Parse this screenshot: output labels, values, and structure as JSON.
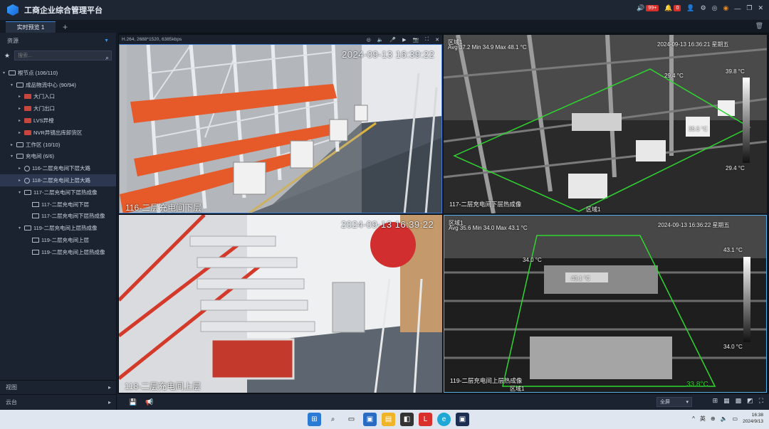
{
  "app": {
    "title": "工商企业综合管理平台",
    "alarm_badge": "99+",
    "msg_badge": "0"
  },
  "tabs": {
    "active": "实时预览 1",
    "add": "+"
  },
  "sidebar": {
    "header": "资源",
    "search_placeholder": "搜索...",
    "tree": [
      {
        "label": "根节点 (106/110)",
        "level": 0,
        "icon": "org",
        "arrow": "▾"
      },
      {
        "label": "成品物流中心 (90/94)",
        "level": 1,
        "icon": "org",
        "arrow": "▾"
      },
      {
        "label": "大门入口",
        "level": 2,
        "icon": "cam",
        "arrow": "▸"
      },
      {
        "label": "大门出口",
        "level": 2,
        "icon": "cam",
        "arrow": "▸"
      },
      {
        "label": "LVS异橙",
        "level": 2,
        "icon": "cam",
        "arrow": "▸"
      },
      {
        "label": "NVR异镜出库卸货区",
        "level": 2,
        "icon": "cam",
        "arrow": "▸"
      },
      {
        "label": "工作区 (10/10)",
        "level": 1,
        "icon": "org",
        "arrow": "▸"
      },
      {
        "label": "充电间 (6/6)",
        "level": 1,
        "icon": "org",
        "arrow": "▾"
      },
      {
        "label": "116-二层充电间下层大路",
        "level": 2,
        "icon": "dome",
        "arrow": "▸"
      },
      {
        "label": "118-二层充电间上层大路",
        "level": 2,
        "icon": "dome",
        "arrow": "▸",
        "selected": true
      },
      {
        "label": "117-二层充电间下层热成像",
        "level": 2,
        "icon": "thermal",
        "arrow": "▾"
      },
      {
        "label": "117-二层充电间下层",
        "level": 3,
        "icon": "screen",
        "arrow": ""
      },
      {
        "label": "117-二层充电间下层热成像",
        "level": 3,
        "icon": "screen",
        "arrow": ""
      },
      {
        "label": "119-二层充电间上层热成像",
        "level": 2,
        "icon": "thermal",
        "arrow": "▾"
      },
      {
        "label": "119-二层充电间上层",
        "level": 3,
        "icon": "screen",
        "arrow": ""
      },
      {
        "label": "119-二层充电间上层热成像",
        "level": 3,
        "icon": "screen",
        "arrow": ""
      }
    ],
    "bottom1": "视图",
    "bottom2": "云台"
  },
  "video": {
    "stream_info": "H.264, 2688*1520, 6385kbps",
    "panes": {
      "tl": {
        "time": "2024-09-13 16:39:22",
        "name": "116-二层充电间下层"
      },
      "bl": {
        "time": "2024-09-13 16:39:22",
        "name": "118-二层充电间上层"
      },
      "tr": {
        "time": "2024-09-13 16:36:21 星期五",
        "stats": "Avg 37.2 Min 34.9 Max 48.1 °C",
        "region": "区域1",
        "scale_max": "39.8 °C",
        "scale_min": "29.4 °C",
        "label1": "29.4 °C",
        "label2": "35.5 °C",
        "name": "117-二层充电间下层热成像",
        "bottom_label": "区域1"
      },
      "br": {
        "time": "2024-09-13 16:36:22 星期五",
        "stats": "Avg 35.6 Min 34.0 Max 43.1 °C",
        "region": "区域1",
        "scale_max": "43.1 °C",
        "scale_min": "34.0 °C",
        "label1": "34.0 °C",
        "label2": "43.1 °C",
        "corner_temp": "33.8°C",
        "name": "119-二层充电间上层热成像",
        "bottom_label": "区域1"
      }
    }
  },
  "toolbar": {
    "layout_select": "全屏"
  },
  "taskbar": {
    "lang": "英",
    "time": "16:38",
    "date": "2024/9/13"
  }
}
